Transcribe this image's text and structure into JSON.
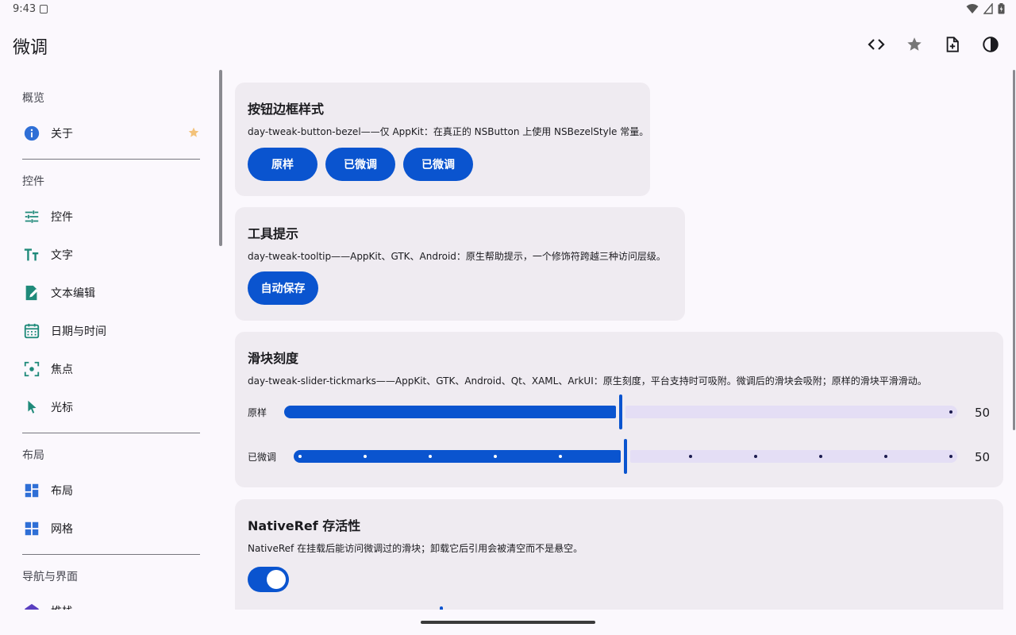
{
  "status": {
    "time": "9:43"
  },
  "app": {
    "title": "微调"
  },
  "actions": [
    "code-icon",
    "star-icon",
    "add-document-icon",
    "contrast-icon"
  ],
  "sidebar": {
    "sections": [
      {
        "title": "概览",
        "items": [
          {
            "label": "关于",
            "icon": "info-icon",
            "starred": true
          }
        ]
      },
      {
        "title": "控件",
        "items": [
          {
            "label": "控件",
            "icon": "tune-icon"
          },
          {
            "label": "文字",
            "icon": "text-size-icon"
          },
          {
            "label": "文本编辑",
            "icon": "edit-note-icon"
          },
          {
            "label": "日期与时间",
            "icon": "calendar-icon"
          },
          {
            "label": "焦点",
            "icon": "focus-icon"
          },
          {
            "label": "光标",
            "icon": "cursor-icon"
          }
        ]
      },
      {
        "title": "布局",
        "items": [
          {
            "label": "布局",
            "icon": "layout-icon"
          },
          {
            "label": "网格",
            "icon": "grid-icon"
          }
        ]
      },
      {
        "title": "导航与界面",
        "items": [
          {
            "label": "堆栈",
            "icon": "stack-icon"
          }
        ]
      }
    ]
  },
  "cards": {
    "bezel": {
      "title": "按钮边框样式",
      "desc": "day-tweak-button-bezel——仅 AppKit：在真正的 NSButton 上使用 NSBezelStyle 常量。",
      "buttons": [
        "原样",
        "已微调",
        "已微调"
      ]
    },
    "tooltip": {
      "title": "工具提示",
      "desc": "day-tweak-tooltip——AppKit、GTK、Android：原生帮助提示，一个修饰符跨越三种访问层级。",
      "button": "自动保存"
    },
    "slider": {
      "title": "滑块刻度",
      "desc": "day-tweak-slider-tickmarks——AppKit、GTK、Android、Qt、XAML、ArkUI：原生刻度，平台支持时可吸附。微调后的滑块会吸附；原样的滑块平滑滑动。",
      "rows": [
        {
          "label": "原样",
          "value": "50",
          "fraction": 0.5
        },
        {
          "label": "已微调",
          "value": "50",
          "fraction": 0.5
        }
      ]
    },
    "nativeref": {
      "title": "NativeRef 存活性",
      "desc": "NativeRef 在挂载后能访问微调过的滑块；卸载它后引用会被清空而不是悬空。",
      "toggle_on": true
    }
  },
  "colors": {
    "primary": "#0a54cf",
    "track": "#e4def5",
    "card": "#efebf1",
    "background": "#fbf8fd",
    "icon_teal": "#1f8a7a",
    "icon_blue": "#2f6fd6"
  }
}
